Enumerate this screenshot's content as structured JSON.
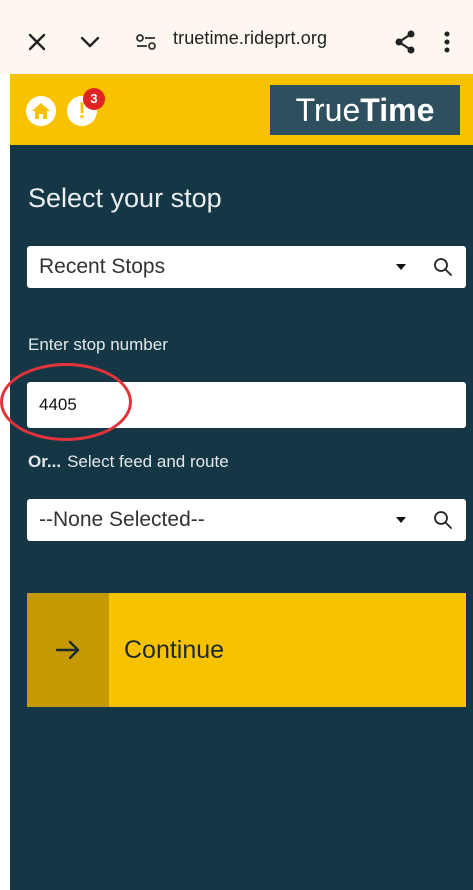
{
  "browser": {
    "url": "truetime.rideprt.org",
    "icons": [
      "close-icon",
      "chevron-down-icon",
      "site-settings-icon",
      "share-icon",
      "more-vertical-icon"
    ]
  },
  "header": {
    "alert_count": "3",
    "logo_light": "True",
    "logo_bold": "Time",
    "colors": {
      "header_bg": "#f7c200",
      "logo_bg": "#2e4f5e",
      "badge": "#e02424"
    }
  },
  "main": {
    "title": "Select your stop",
    "recent_select": {
      "value": "Recent Stops"
    },
    "stop_number_label": "Enter stop number",
    "stop_number_value": "4405",
    "route_label_prefix": "Or...",
    "route_label": "Select feed and route",
    "route_select": {
      "value": "--None Selected--"
    },
    "continue_label": "Continue",
    "colors": {
      "panel_bg": "#153745",
      "annotation_circle": "#e2333b"
    }
  }
}
